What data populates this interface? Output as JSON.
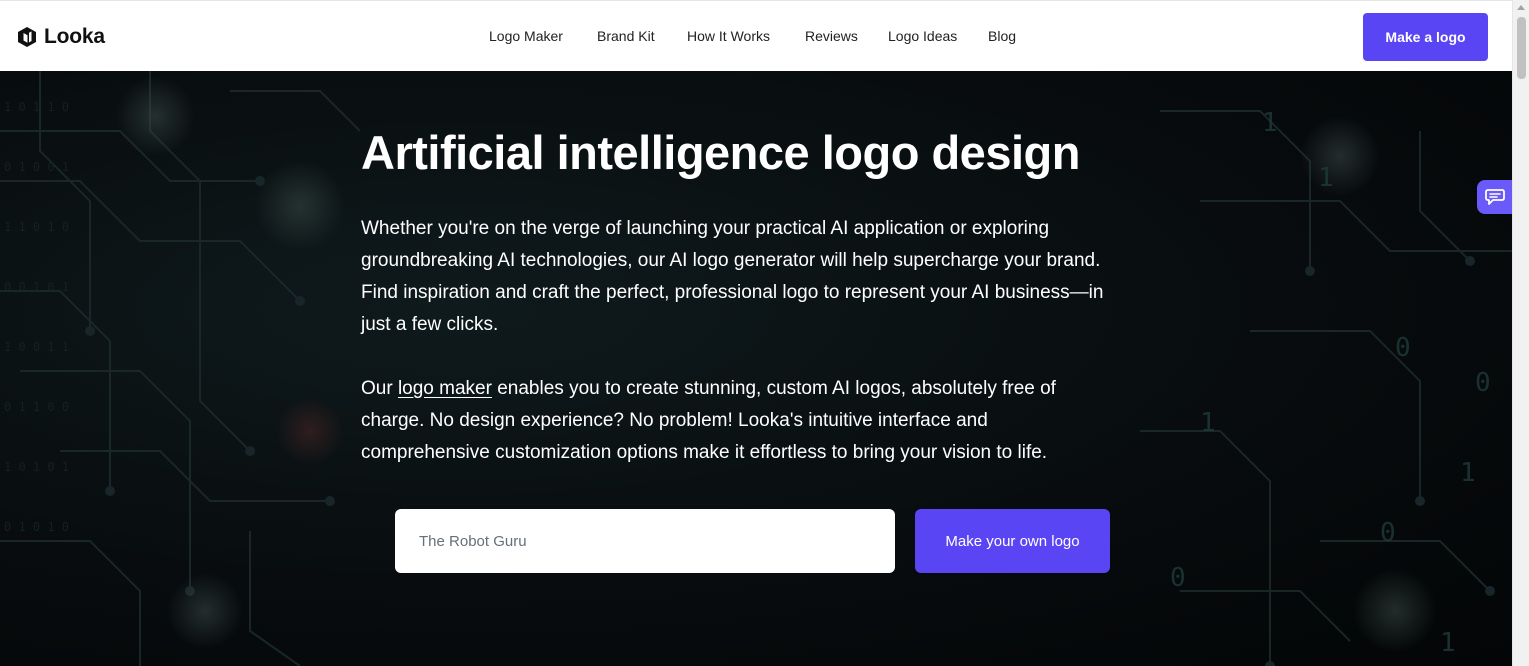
{
  "brand": {
    "name": "Looka",
    "accent": "#5a45f5"
  },
  "nav": {
    "links": [
      "Logo Maker",
      "Brand Kit",
      "How It Works",
      "Reviews",
      "Logo Ideas",
      "Blog"
    ],
    "cta": "Make a logo"
  },
  "hero": {
    "title": "Artificial intelligence logo design",
    "p1": "Whether you're on the verge of launching your practical AI application or exploring groundbreaking AI technologies, our AI logo generator will help supercharge your brand. Find inspiration and craft the perfect, professional logo to represent your AI business—in just a few clicks.",
    "p2_before": "Our ",
    "p2_link": "logo maker",
    "p2_after": " enables you to create stunning, custom AI logos, absolutely free of charge. No design experience? No problem! Looka's intuitive interface and comprehensive customization options make it effortless to bring your vision to life.",
    "input_placeholder": "The Robot Guru",
    "cta": "Make your own logo"
  },
  "chat": {
    "icon": "chat-bubble-icon"
  }
}
